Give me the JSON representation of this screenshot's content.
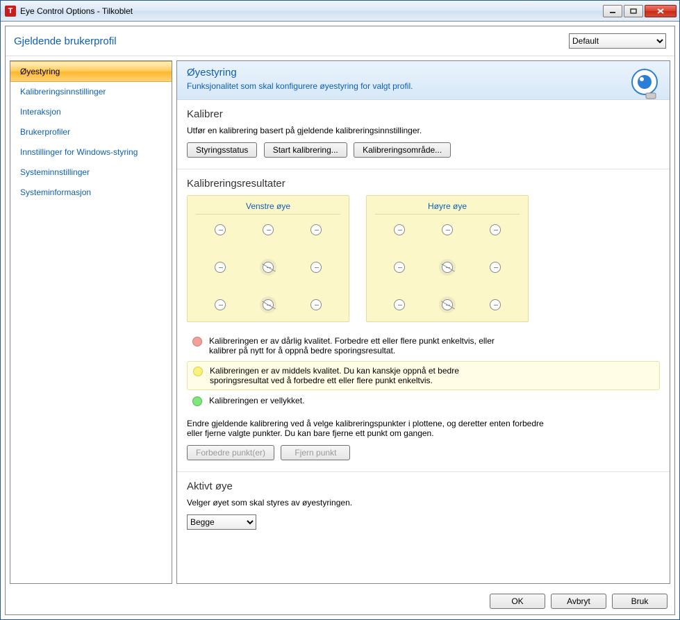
{
  "window": {
    "title": "Eye Control Options - Tilkoblet"
  },
  "profile": {
    "label": "Gjeldende brukerprofil",
    "selected": "Default"
  },
  "sidebar": {
    "items": [
      "Øyestyring",
      "Kalibreringsinnstillinger",
      "Interaksjon",
      "Brukerprofiler",
      "Innstillinger for Windows-styring",
      "Systeminnstillinger",
      "Systeminformasjon"
    ]
  },
  "header": {
    "title": "Øyestyring",
    "desc": "Funksjonalitet som skal konfigurere øyestyring for valgt profil."
  },
  "calibrate": {
    "title": "Kalibrer",
    "desc": "Utfør en kalibrering basert på gjeldende kalibreringsinnstillinger.",
    "btn_status": "Styringsstatus",
    "btn_start": "Start kalibrering...",
    "btn_area": "Kalibreringsområde..."
  },
  "results": {
    "title": "Kalibreringsresultater",
    "left_eye": "Venstre øye",
    "right_eye": "Høyre øye",
    "legend_red": "Kalibreringen er av dårlig kvalitet. Forbedre ett eller flere punkt enkeltvis, eller kalibrer på nytt for å oppnå bedre sporingsresultat.",
    "legend_yellow": "Kalibreringen er av middels kvalitet. Du kan kanskje oppnå et bedre sporingsresultat ved å forbedre ett eller flere punkt enkeltvis.",
    "legend_green": "Kalibreringen er vellykket.",
    "note": "Endre gjeldende kalibrering ved å velge kalibreringspunkter i plottene, og deretter enten forbedre eller fjerne valgte punkter. Du kan bare fjerne ett punkt om gangen.",
    "btn_improve": "Forbedre punkt(er)",
    "btn_remove": "Fjern punkt"
  },
  "active_eye": {
    "title": "Aktivt øye",
    "desc": "Velger øyet som skal styres av øyestyringen.",
    "selected": "Begge"
  },
  "footer": {
    "ok": "OK",
    "cancel": "Avbryt",
    "apply": "Bruk"
  }
}
